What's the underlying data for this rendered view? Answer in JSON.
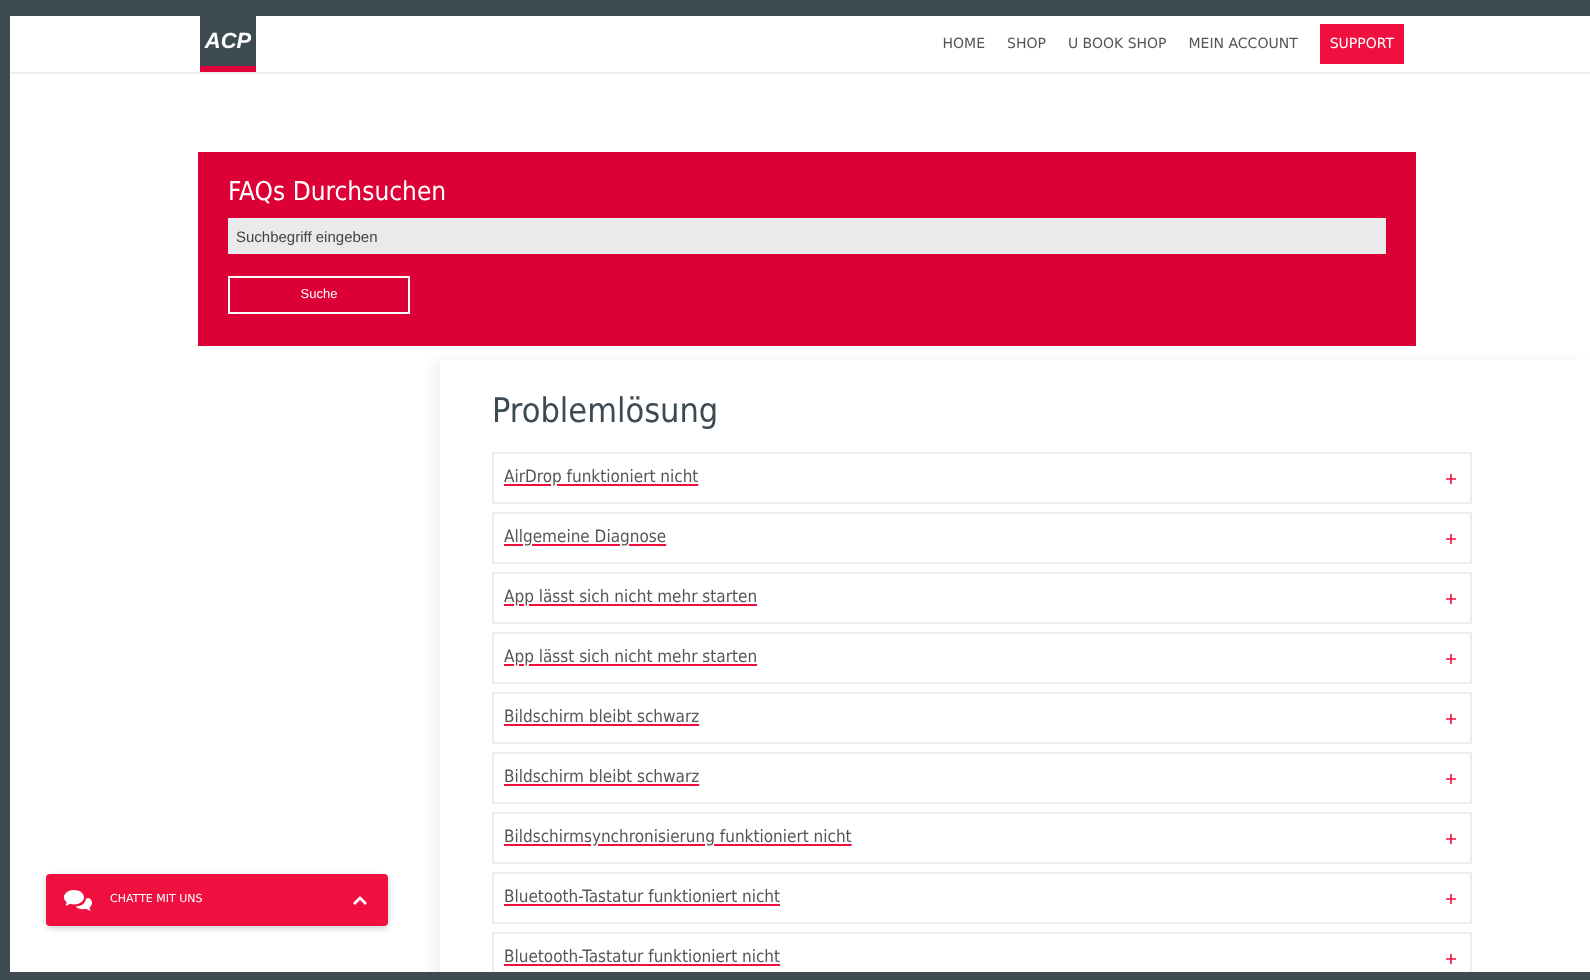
{
  "header": {
    "logo": "ACP",
    "nav": [
      {
        "label": "HOME",
        "selected": false
      },
      {
        "label": "SHOP",
        "selected": false
      },
      {
        "label": "U BOOK SHOP",
        "selected": false
      },
      {
        "label": "MEIN ACCOUNT",
        "selected": false
      },
      {
        "label": "SUPPORT",
        "selected": true
      }
    ]
  },
  "search": {
    "title": "FAQs Durchsuchen",
    "placeholder": "Suchbegriff eingeben",
    "button": "Suche"
  },
  "faq": {
    "title": "Problemlösung",
    "items": [
      {
        "label": "AirDrop funktioniert nicht"
      },
      {
        "label": "Allgemeine Diagnose"
      },
      {
        "label": "App lässt sich nicht mehr starten"
      },
      {
        "label": "App lässt sich nicht mehr starten"
      },
      {
        "label": "Bildschirm bleibt schwarz"
      },
      {
        "label": "Bildschirm bleibt schwarz"
      },
      {
        "label": "Bildschirmsynchronisierung funktioniert nicht"
      },
      {
        "label": "Bluetooth-Tastatur funktioniert nicht"
      },
      {
        "label": "Bluetooth-Tastatur funktioniert nicht"
      }
    ]
  },
  "chat": {
    "label": "CHATTE MIT UNS"
  }
}
